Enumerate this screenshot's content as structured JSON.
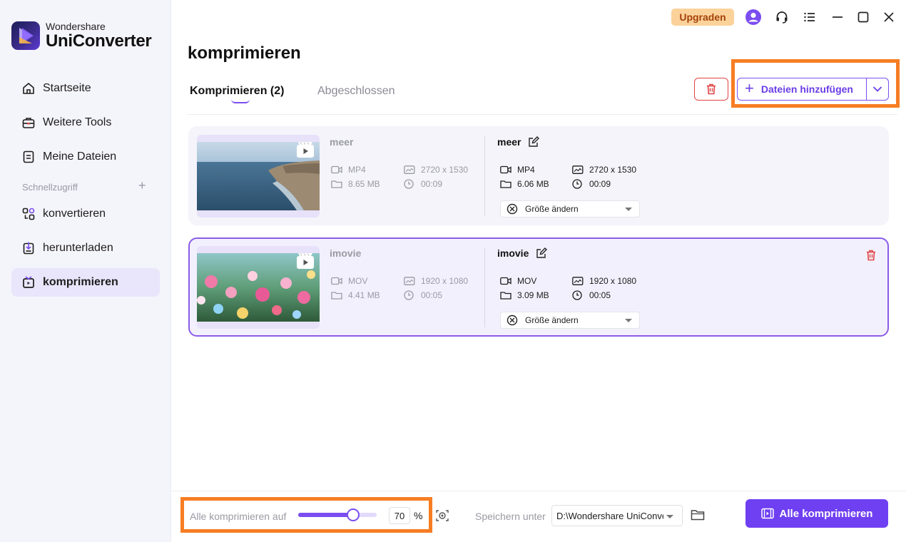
{
  "app": {
    "brand_small": "Wondershare",
    "brand_big": "UniConverter",
    "upgrade_label": "Upgraden"
  },
  "sidebar": {
    "items": [
      {
        "label": "Startseite",
        "icon": "home-icon"
      },
      {
        "label": "Weitere Tools",
        "icon": "toolbox-icon"
      },
      {
        "label": "Meine Dateien",
        "icon": "file-icon"
      }
    ],
    "section_label": "Schnellzugriff",
    "section_plus": "+",
    "quick": [
      {
        "label": "konvertieren",
        "icon": "convert-icon"
      },
      {
        "label": "herunterladen",
        "icon": "download-icon"
      },
      {
        "label": "komprimieren",
        "icon": "compress-icon",
        "active": true
      }
    ]
  },
  "main": {
    "title": "komprimieren",
    "tab_active": "Komprimieren (2)",
    "tab_inactive": "Abgeschlossen",
    "add_files_label": "Dateien hinzufügen"
  },
  "files": [
    {
      "src": {
        "name": "meer",
        "format": "MP4",
        "size": "8.65 MB",
        "resolution": "2720 x 1530",
        "duration": "00:09"
      },
      "dst": {
        "name": "meer",
        "format": "MP4",
        "size": "6.06 MB",
        "resolution": "2720 x 1530",
        "duration": "00:09"
      },
      "size_option": "Größe ändern"
    },
    {
      "src": {
        "name": "imovie",
        "format": "MOV",
        "size": "4.41 MB",
        "resolution": "1920 x 1080",
        "duration": "00:05"
      },
      "dst": {
        "name": "imovie",
        "format": "MOV",
        "size": "3.09 MB",
        "resolution": "1920 x 1080",
        "duration": "00:05"
      },
      "size_option": "Größe ändern"
    }
  ],
  "bottom": {
    "compress_label": "Alle komprimieren auf",
    "percent_value": "70",
    "percent_sign": "%",
    "save_label": "Speichern unter",
    "save_path": "D:\\Wondershare UniConverter",
    "compress_all_label": "Alle komprimieren"
  },
  "colors": {
    "accent": "#6f3ff2",
    "highlight": "#f77d23",
    "danger": "#e04444",
    "upgrade_bg": "#fbd29a"
  }
}
